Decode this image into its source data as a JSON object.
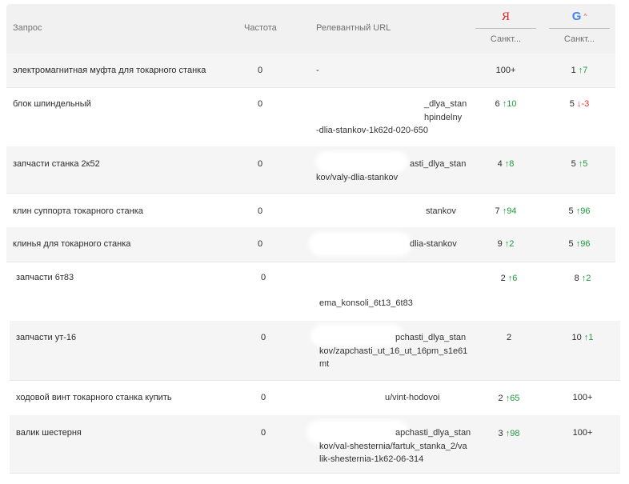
{
  "header": {
    "query": "Запрос",
    "frequency": "Частота",
    "url": "Релевантный URL",
    "yandex_logo": "Я",
    "google_logo": "G",
    "google_caret": "^",
    "yandex_region": "Санкт...",
    "google_region": "Санкт..."
  },
  "rows": [
    {
      "query": "электромагнитная муфта для токарного станка",
      "freq": "0",
      "url": [
        "-"
      ],
      "y_pos": "100+",
      "y_delta": "",
      "g_pos": "1",
      "g_delta": "↑7"
    },
    {
      "query": "блок шпиндельный",
      "freq": "0",
      "url": [
        "_dlya_stan",
        "hpindelny",
        "-dlia-stankov-1k62d-020-650"
      ],
      "y_pos": "6",
      "y_delta": "↑10",
      "g_pos": "5",
      "g_delta": "↓-3"
    },
    {
      "query": "запчасти станка 2к52",
      "freq": "0",
      "url": [
        "asti_dlya_stan",
        "kov/valy-dlia-stankov"
      ],
      "y_pos": "4",
      "y_delta": "↑8",
      "g_pos": "5",
      "g_delta": "↑5"
    },
    {
      "query": "клин суппорта токарного станка",
      "freq": "0",
      "url": [
        "stankov"
      ],
      "y_pos": "7",
      "y_delta": "↑94",
      "g_pos": "5",
      "g_delta": "↑96"
    },
    {
      "query": "клинья для токарного станка",
      "freq": "0",
      "url": [
        "dlia-stankov"
      ],
      "y_pos": "9",
      "y_delta": "↑2",
      "g_pos": "5",
      "g_delta": "↑96"
    },
    {
      "query": "запчасти 6т83",
      "freq": "0",
      "url": [
        "",
        "",
        "ema_konsoli_6t13_6t83"
      ],
      "y_pos": "2",
      "y_delta": "↑6",
      "g_pos": "8",
      "g_delta": "↑2"
    },
    {
      "query": "запчасти ут-16",
      "freq": "0",
      "url": [
        "pchasti_dlya_stan",
        "kov/zapchasti_ut_16_ut_16pm_s1e61",
        "mt"
      ],
      "y_pos": "2",
      "y_delta": "",
      "g_pos": "10",
      "g_delta": "↑1"
    },
    {
      "query": "ходовой винт токарного станка купить",
      "freq": "0",
      "url": [
        "u/vint-hodovoi"
      ],
      "y_pos": "2",
      "y_delta": "↑65",
      "g_pos": "100+",
      "g_delta": ""
    },
    {
      "query": "валик шестерня",
      "freq": "0",
      "url": [
        "apchasti_dlya_stan",
        "kov/val-shesternia/fartuk_stanka_2/va",
        "lik-shesternia-1k62-06-314"
      ],
      "y_pos": "3",
      "y_delta": "↑98",
      "g_pos": "100+",
      "g_delta": ""
    }
  ]
}
